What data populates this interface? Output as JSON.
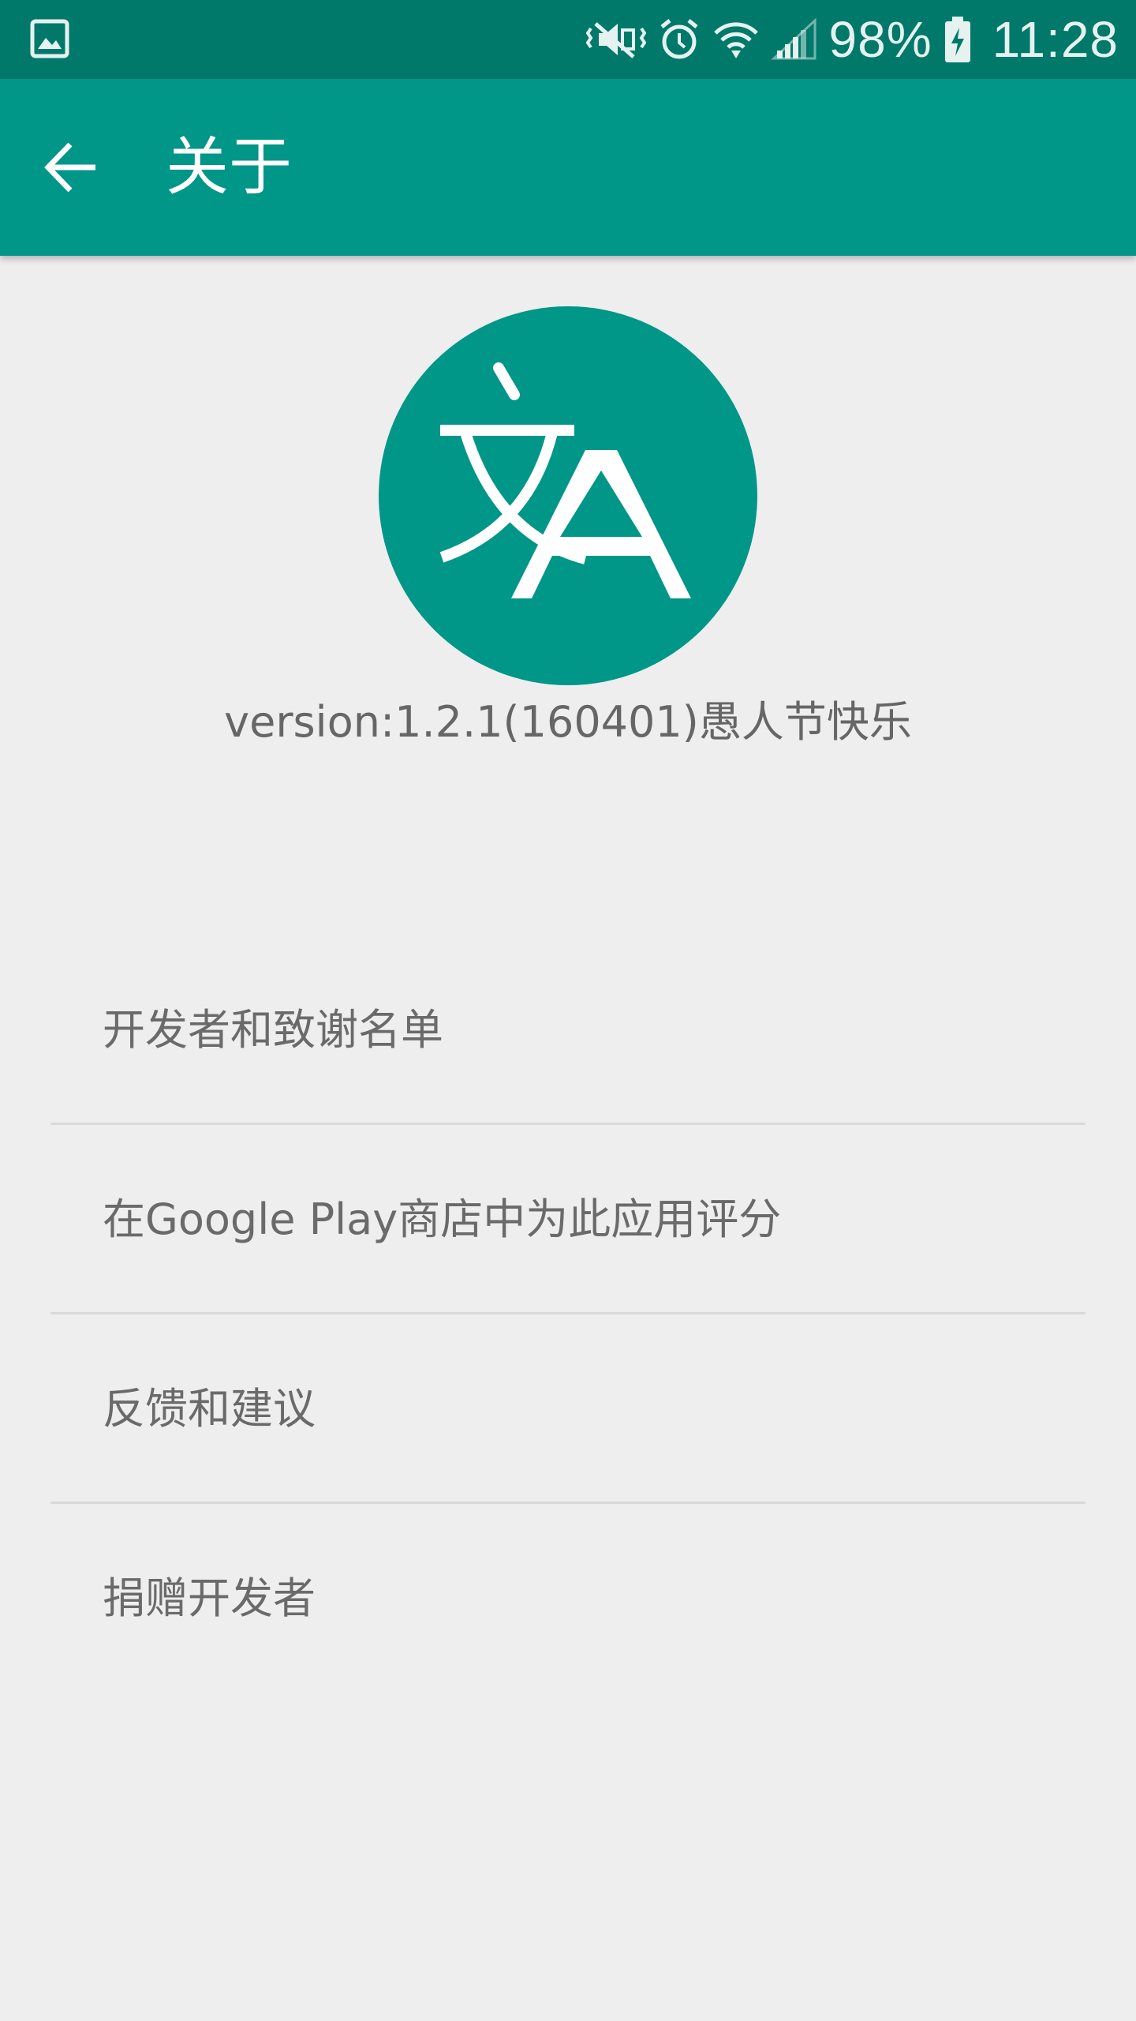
{
  "status_bar": {
    "battery_percent": "98%",
    "time": "11:28",
    "icons": [
      "image-notification-icon",
      "mute-vibrate-icon",
      "alarm-icon",
      "wifi-icon",
      "signal-icon",
      "battery-charging-icon"
    ]
  },
  "app_bar": {
    "title": "关于",
    "back_icon": "arrow-back-icon"
  },
  "logo": {
    "icon": "translate-icon",
    "color": "#009688"
  },
  "version": "version:1.2.1(160401)愚人节快乐",
  "menu": {
    "items": [
      {
        "label": "开发者和致谢名单"
      },
      {
        "label": "在Google Play商店中为此应用评分"
      },
      {
        "label": "反馈和建议"
      },
      {
        "label": "捐赠开发者"
      }
    ]
  },
  "colors": {
    "primary": "#009688",
    "primary_dark": "#00796b",
    "background": "#eeeeef",
    "text_secondary": "#6a6a6a"
  }
}
